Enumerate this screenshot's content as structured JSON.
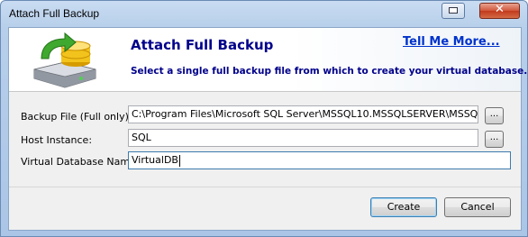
{
  "window": {
    "title": "Attach Full Backup",
    "close_glyph": "✕"
  },
  "header": {
    "title": "Attach Full Backup",
    "help_link": "Tell Me More...",
    "subtitle": "Select a single full backup file from which to create your virtual database.",
    "icon": "database-attach-icon"
  },
  "form": {
    "backup_file": {
      "label": "Backup File (Full only):",
      "value": "C:\\Program Files\\Microsoft SQL Server\\MSSQL10.MSSQLSERVER\\MSSQL\\Ba",
      "browse_label": "..."
    },
    "host_instance": {
      "label": "Host Instance:",
      "value": "SQL",
      "browse_label": "..."
    },
    "virtual_db_name": {
      "label": "Virtual Database Name:",
      "value": "VirtualDB"
    }
  },
  "buttons": {
    "create": "Create",
    "cancel": "Cancel"
  },
  "colors": {
    "header_text": "#00008b",
    "link": "#0033cc",
    "close_button": "#c2391c"
  }
}
